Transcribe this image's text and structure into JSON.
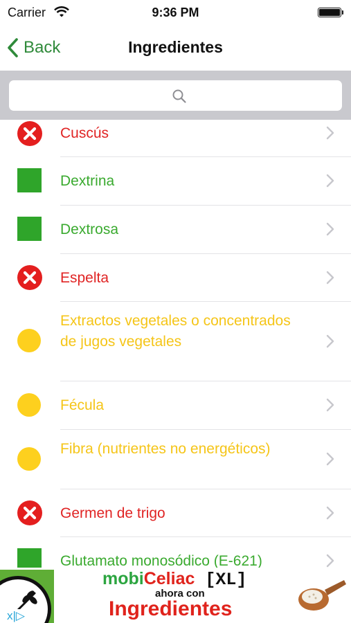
{
  "status_bar": {
    "carrier": "Carrier",
    "time": "9:36 PM"
  },
  "nav": {
    "back_label": "Back",
    "title": "Ingredientes"
  },
  "search": {
    "placeholder": ""
  },
  "colors": {
    "forbidden": "#e02424",
    "allowed": "#3aaa2f",
    "caution": "#f5c518",
    "tint": "#2f8a3a"
  },
  "ingredients": [
    {
      "name": "Cuscús",
      "status": "forbidden"
    },
    {
      "name": "Dextrina",
      "status": "allowed"
    },
    {
      "name": "Dextrosa",
      "status": "allowed"
    },
    {
      "name": "Espelta",
      "status": "forbidden"
    },
    {
      "name": "Extractos vegetales o concentrados de jugos vegetales",
      "status": "caution"
    },
    {
      "name": "Fécula",
      "status": "caution"
    },
    {
      "name": "Fibra (nutrientes no energéticos)",
      "status": "caution"
    },
    {
      "name": "Germen de trigo",
      "status": "forbidden"
    },
    {
      "name": "Glutamato monosódico (E-621)",
      "status": "allowed"
    }
  ],
  "ad": {
    "brand_part1": "mobi",
    "brand_part2": "Celiac",
    "brand_part3": " [XL]",
    "subtitle": "ahora con",
    "headline": "Ingredientes",
    "adchoices": "x|▷"
  }
}
